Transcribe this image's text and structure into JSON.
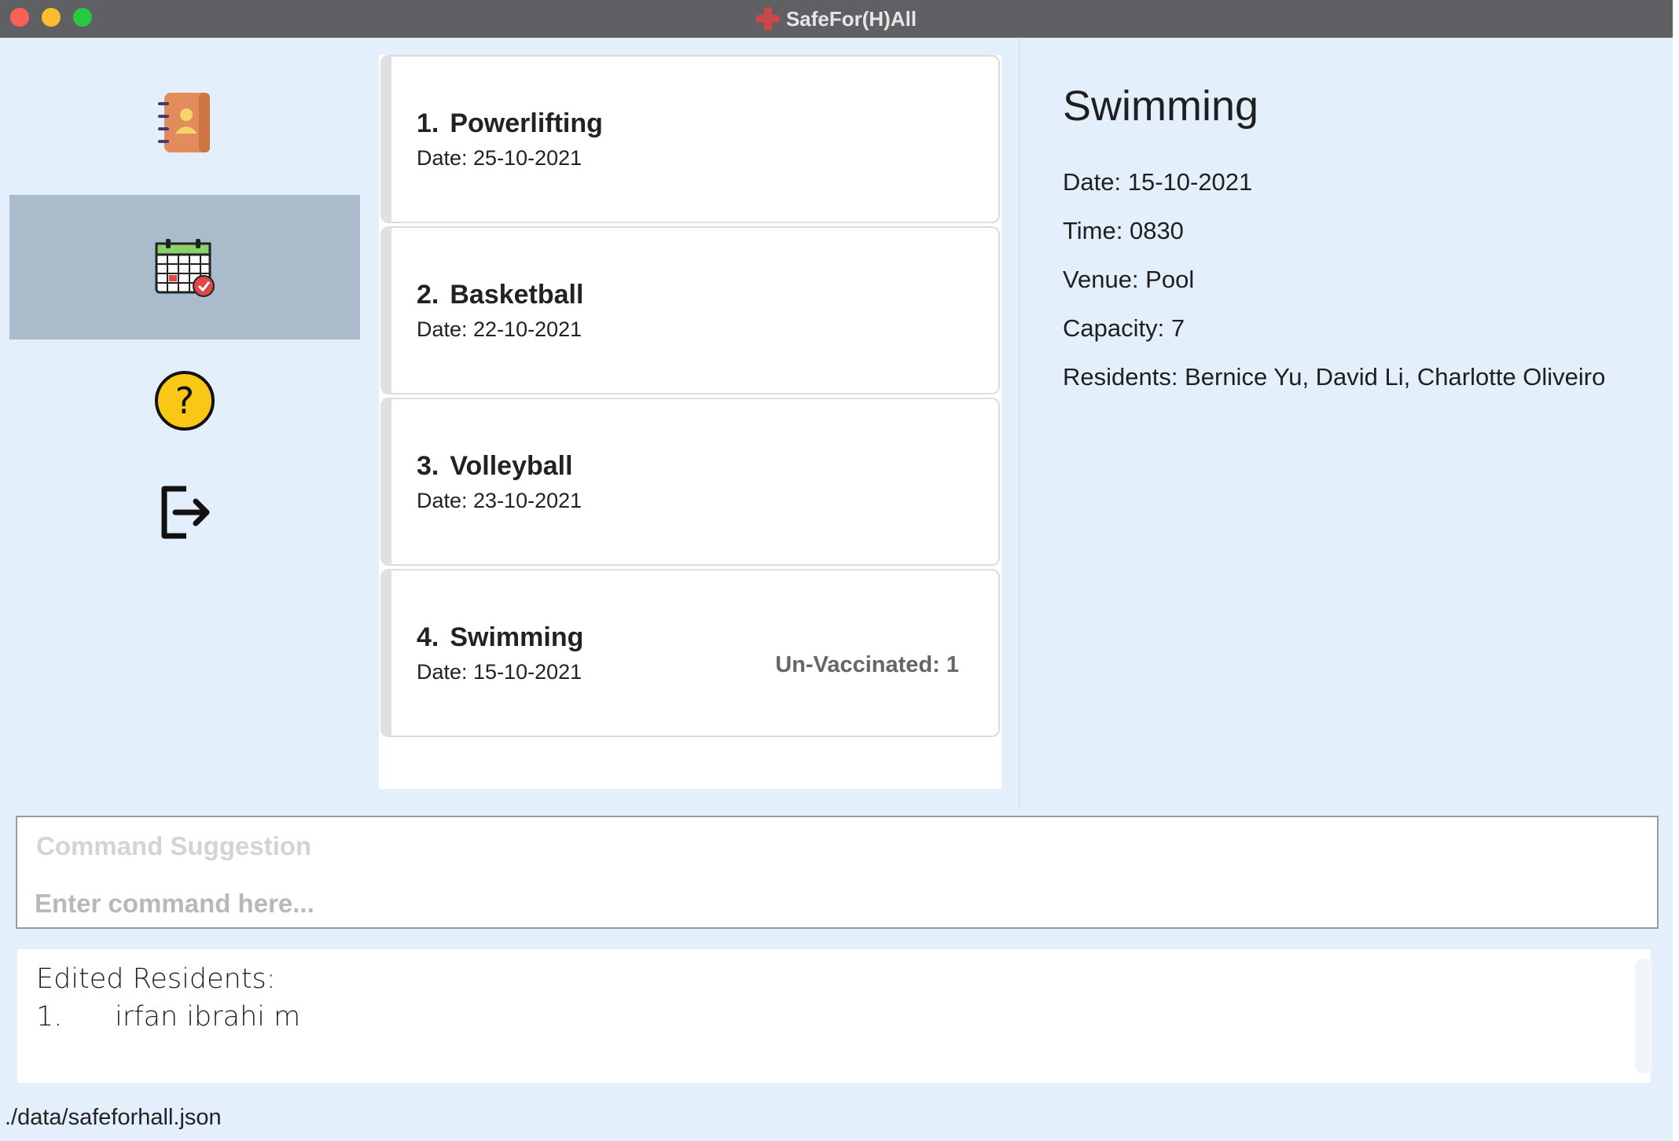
{
  "window": {
    "title": "SafeFor(H)All"
  },
  "sidebar": {
    "items": [
      {
        "name": "residents",
        "icon": "address-book-icon",
        "active": false
      },
      {
        "name": "events",
        "icon": "calendar-icon",
        "active": true
      },
      {
        "name": "help",
        "icon": "help-icon",
        "active": false
      },
      {
        "name": "exit",
        "icon": "exit-icon",
        "active": false
      }
    ]
  },
  "events": [
    {
      "index": "1.",
      "name": "Powerlifting",
      "date": "Date: 25-10-2021",
      "tag": ""
    },
    {
      "index": "2.",
      "name": "Basketball",
      "date": "Date: 22-10-2021",
      "tag": ""
    },
    {
      "index": "3.",
      "name": "Volleyball",
      "date": "Date: 23-10-2021",
      "tag": ""
    },
    {
      "index": "4.",
      "name": "Swimming",
      "date": "Date: 15-10-2021",
      "tag": "Un-Vaccinated: 1"
    }
  ],
  "detail": {
    "title": "Swimming",
    "date": "Date: 15-10-2021",
    "time": "Time: 0830",
    "venue": "Venue: Pool",
    "capacity": "Capacity: 7",
    "residents": "Residents: Bernice Yu, David Li, Charlotte Oliveiro"
  },
  "command": {
    "suggestion": "Command Suggestion",
    "placeholder": "Enter command here...",
    "value": ""
  },
  "result": {
    "heading": "Edited Residents:",
    "line1": "1.      irfan ibrahi m"
  },
  "status": {
    "path": "./data/safeforhall.json"
  },
  "colors": {
    "background": "#e3f0fc",
    "active_sidebar": "#aabbcc",
    "titlebar": "#5f6063"
  }
}
